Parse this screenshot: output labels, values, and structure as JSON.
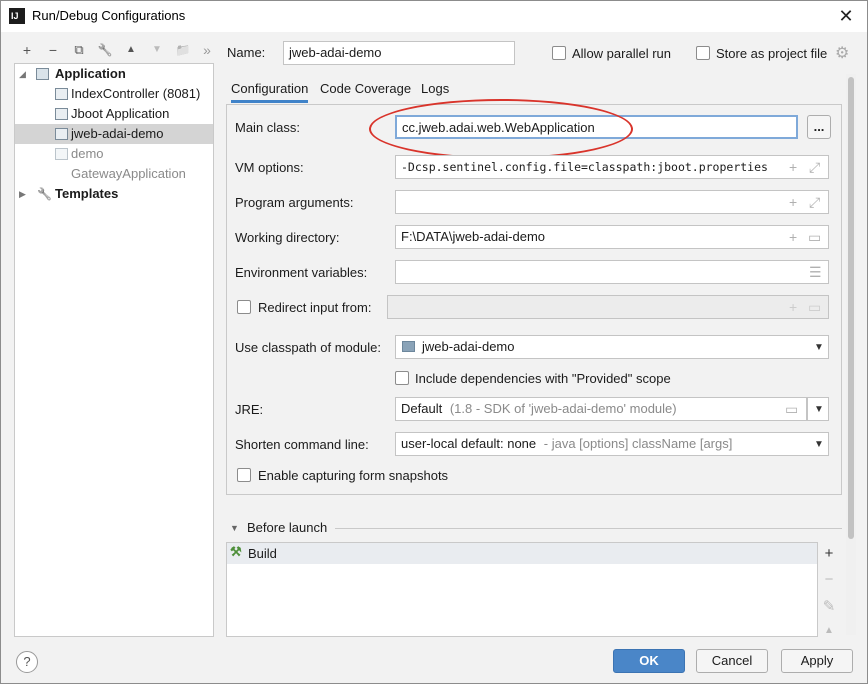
{
  "window": {
    "title": "Run/Debug Configurations",
    "close_icon": "close-icon"
  },
  "toolbar": {
    "icons": [
      "add-icon",
      "remove-icon",
      "copy-icon",
      "wrench-icon",
      "move-up-icon",
      "move-down-icon",
      "folder-add-icon",
      "more-icon"
    ],
    "glyphs": {
      "add": "+",
      "remove": "−",
      "copy": "⧉",
      "wrench": "🔧",
      "up": "▲",
      "down": "▼",
      "folder": "📁",
      "more": "»"
    }
  },
  "tree": {
    "application_label": "Application",
    "items": [
      "IndexController (8081)",
      "Jboot Application",
      "jweb-adai-demo",
      "demo",
      "GatewayApplication"
    ],
    "templates_label": "Templates"
  },
  "header": {
    "name_label": "Name:",
    "name_value": "jweb-adai-demo",
    "allow_parallel_label": "Allow parallel run",
    "store_project_label": "Store as project file"
  },
  "tabs": [
    "Configuration",
    "Code Coverage",
    "Logs"
  ],
  "form": {
    "main_class_label": "Main class:",
    "main_class_value": "cc.jweb.adai.web.WebApplication",
    "browse_label": "...",
    "vm_options_label": "VM options:",
    "vm_options_value": "-Dcsp.sentinel.config.file=classpath:jboot.properties",
    "program_args_label": "Program arguments:",
    "program_args_value": "",
    "working_dir_label": "Working directory:",
    "working_dir_value": "F:\\DATA\\jweb-adai-demo",
    "env_vars_label": "Environment variables:",
    "env_vars_value": "",
    "redirect_label": "Redirect input from:",
    "classpath_label": "Use classpath of module:",
    "classpath_value": "jweb-adai-demo",
    "include_deps_label": "Include dependencies with \"Provided\" scope",
    "jre_label": "JRE:",
    "jre_value": "Default",
    "jre_hint": "(1.8 - SDK of 'jweb-adai-demo' module)",
    "shorten_label": "Shorten command line:",
    "shorten_value": "user-local default: none",
    "shorten_hint": "- java [options] className [args]",
    "capture_label": "Enable capturing form snapshots"
  },
  "before_launch": {
    "label": "Before launch",
    "items": [
      "Build"
    ],
    "side": {
      "add": "+",
      "remove": "−",
      "edit": "✎",
      "up": "▲"
    }
  },
  "footer": {
    "help": "?",
    "ok": "OK",
    "cancel": "Cancel",
    "apply": "Apply"
  }
}
